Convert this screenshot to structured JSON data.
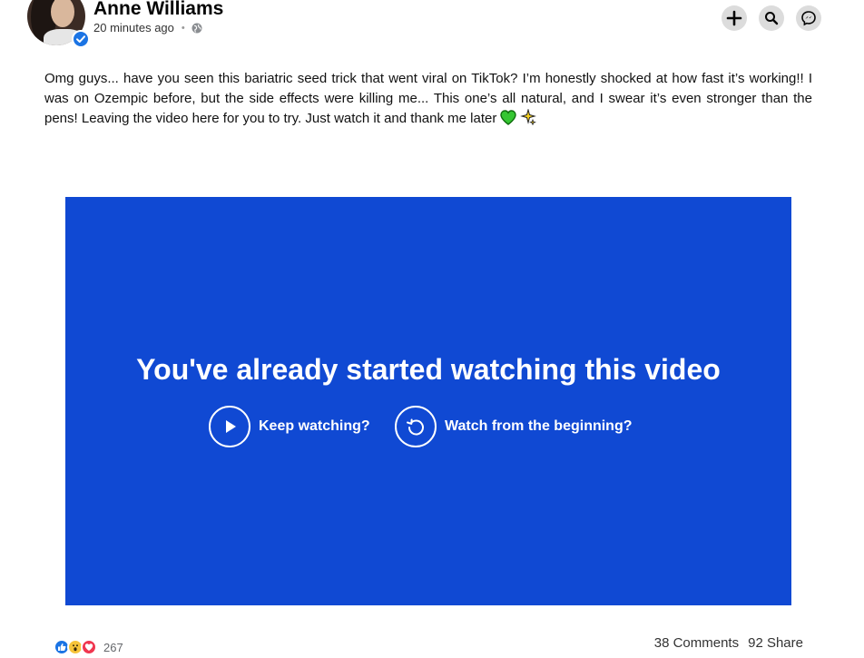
{
  "post": {
    "author": "Anne Williams",
    "timestamp": "20 minutes ago",
    "separator": "•",
    "audience_icon": "globe-icon",
    "verified_icon": "verified-badge-icon",
    "text": "Omg guys... have you seen this bariatric seed trick that went viral on TikTok? I’m honestly shocked at how fast it’s working!! I was on Ozempic before, but the side effects were killing me... This one’s all natural, and I swear it’s even stronger than the pens! Leaving the video here for you to try. Just watch it and thank me later",
    "text_emojis": [
      "green-heart-emoji",
      "sparkles-emoji"
    ]
  },
  "header_actions": [
    {
      "name": "create-button",
      "icon": "plus-icon"
    },
    {
      "name": "search-button",
      "icon": "search-icon"
    },
    {
      "name": "messenger-button",
      "icon": "messenger-icon"
    }
  ],
  "video": {
    "background": "#1049d3",
    "title": "You've already started watching this video",
    "keep_label": "Keep watching?",
    "restart_label": "Watch from the beginning?",
    "keep_icon": "play-icon",
    "restart_icon": "restart-icon"
  },
  "engagement": {
    "reactions": [
      "like-reaction-icon",
      "wow-reaction-icon",
      "love-reaction-icon"
    ],
    "reaction_count": "267",
    "comments": "38 Comments",
    "shares": "92 Share"
  },
  "colors": {
    "brand_blue": "#1b74e4",
    "video_blue": "#1049d3",
    "icon_button_bg": "#dcdcdc"
  }
}
